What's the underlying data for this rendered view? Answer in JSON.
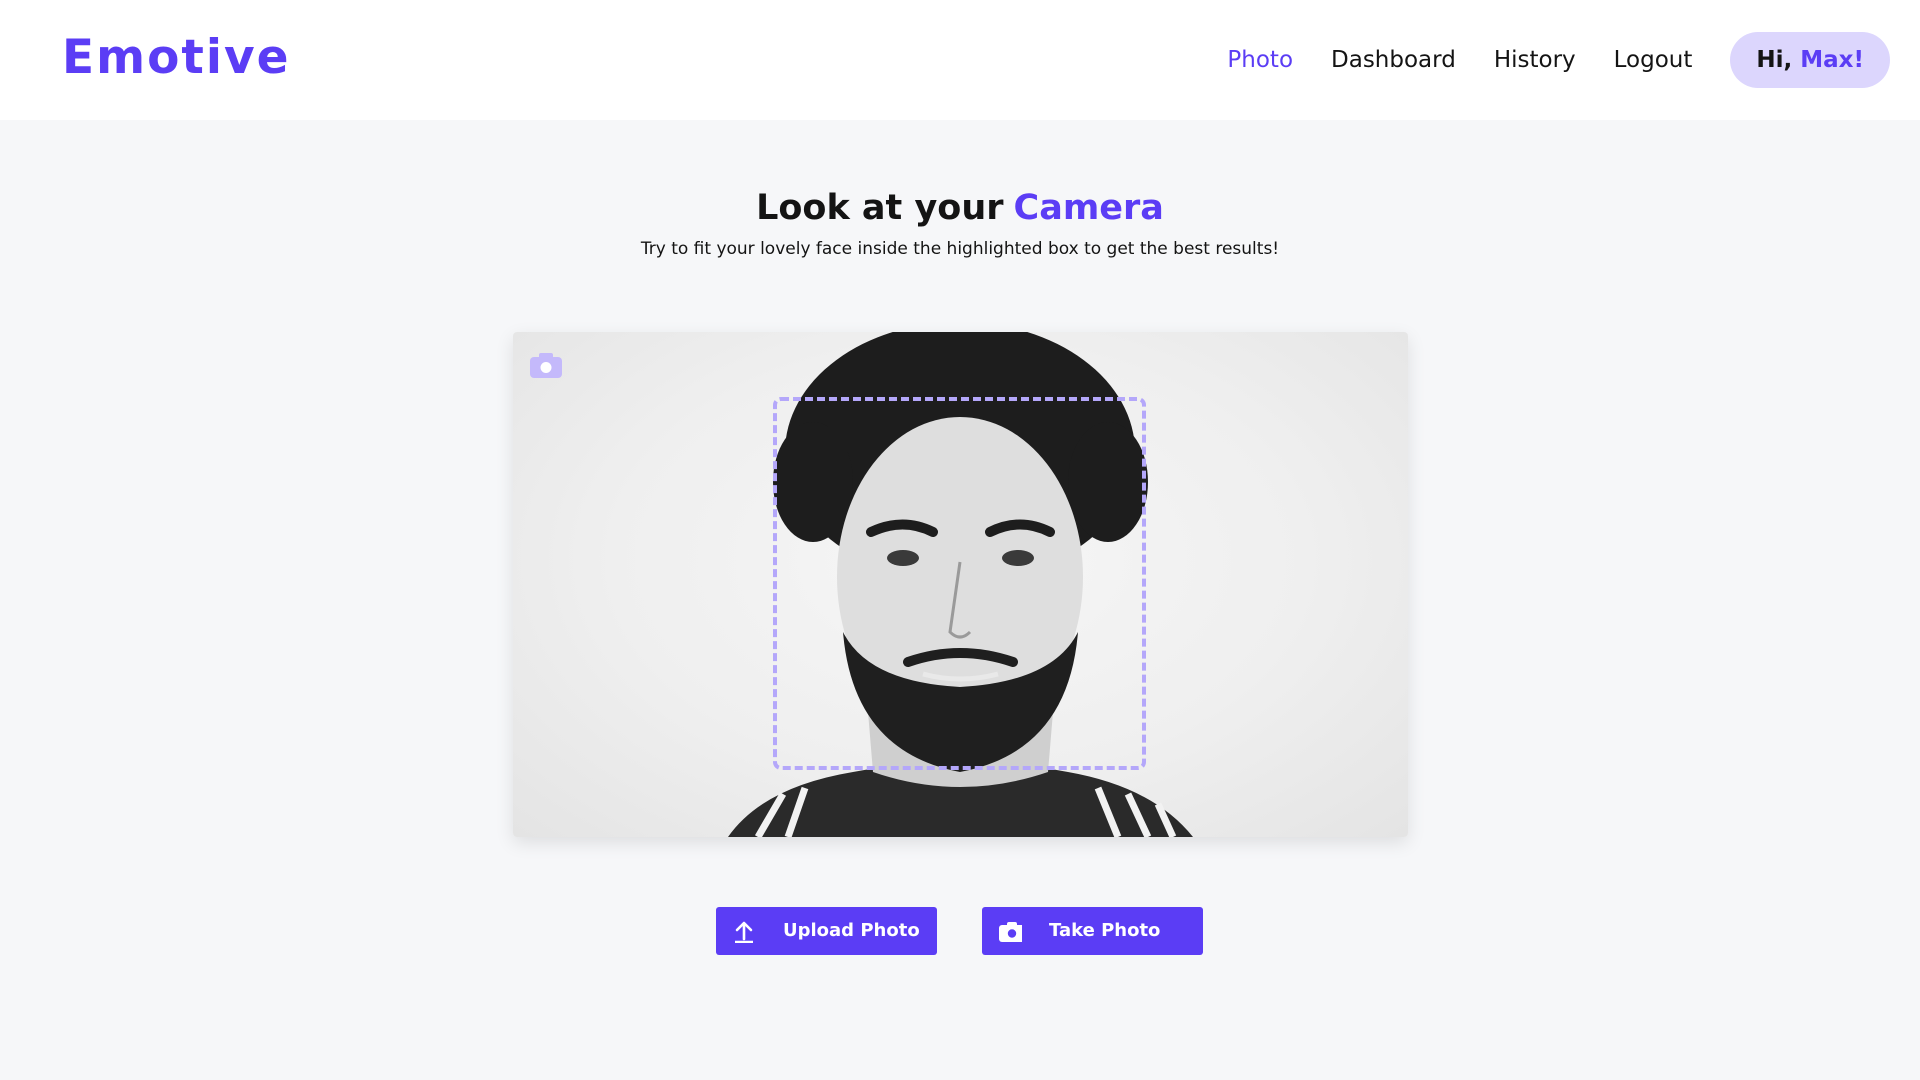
{
  "app": {
    "logo": "Emotive"
  },
  "nav": {
    "items": [
      {
        "label": "Photo",
        "active": true
      },
      {
        "label": "Dashboard",
        "active": false
      },
      {
        "label": "History",
        "active": false
      },
      {
        "label": "Logout",
        "active": false
      }
    ],
    "greeting_prefix": "Hi,",
    "greeting_name": "Max!"
  },
  "main": {
    "title_prefix": "Look at your",
    "title_accent": "Camera",
    "subtitle": "Try to fit your lovely face inside the highlighted box to get the best results!"
  },
  "camera": {
    "corner_icon": "camera-icon"
  },
  "actions": {
    "upload_label": "Upload Photo",
    "upload_icon": "upload-icon",
    "take_label": "Take Photo",
    "take_icon": "camera-icon"
  },
  "colors": {
    "accent": "#5b3df5",
    "accent_light": "#dcd6fd",
    "dashed_box": "#b4a7fa",
    "background": "#f6f7f9"
  }
}
